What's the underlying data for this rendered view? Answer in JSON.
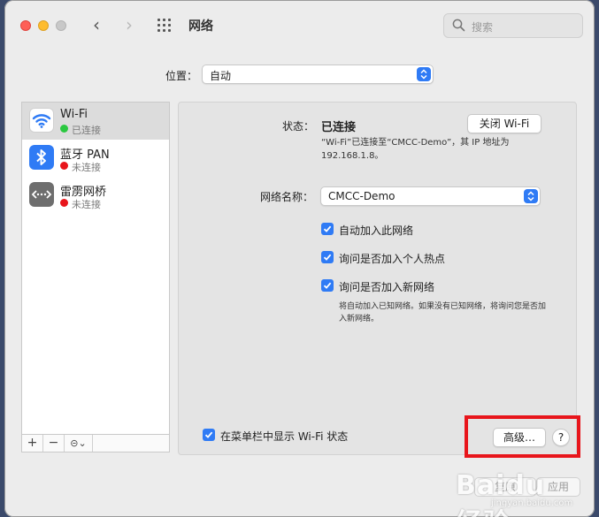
{
  "window": {
    "title": "网络",
    "search_placeholder": "搜索"
  },
  "location": {
    "label": "位置：",
    "value": "自动"
  },
  "services": [
    {
      "name": "Wi-Fi",
      "status": "已连接",
      "status_color": "#2bc840",
      "icon": "wifi-icon"
    },
    {
      "name": "蓝牙 PAN",
      "status": "未连接",
      "status_color": "#e8151b",
      "icon": "bluetooth-icon"
    },
    {
      "name": "雷雳网桥",
      "status": "未连接",
      "status_color": "#e8151b",
      "icon": "thunderbolt-bridge-icon"
    }
  ],
  "sidebar_toolbar": {
    "add": "+",
    "remove": "−",
    "action": "⊝⌄"
  },
  "detail": {
    "status_label": "状态：",
    "status_value": "已连接",
    "wifi_off_button": "关闭 Wi-Fi",
    "status_description": "“Wi-Fi”已连接至“CMCC-Demo”，其 IP 地址为 192.168.1.8。",
    "network_name_label": "网络名称：",
    "network_name_value": "CMCC-Demo",
    "checkboxes": [
      {
        "label": "自动加入此网络",
        "checked": true
      },
      {
        "label": "询问是否加入个人热点",
        "checked": true
      },
      {
        "label": "询问是否加入新网络",
        "checked": true
      }
    ],
    "note": "将自动加入已知网络。如果没有已知网络，将询问您是否加入新网络。",
    "menubar_checkbox": {
      "label": "在菜单栏中显示 Wi-Fi 状态",
      "checked": true
    },
    "advanced_button": "高级…",
    "help_button": "?"
  },
  "footer": {
    "revert": "复原",
    "apply": "应用"
  },
  "watermark": {
    "text": "Baidu 经验",
    "sub": "jingyan.baidu.com"
  },
  "colors": {
    "accent": "#2f7bf5",
    "highlight": "#e8151b"
  }
}
